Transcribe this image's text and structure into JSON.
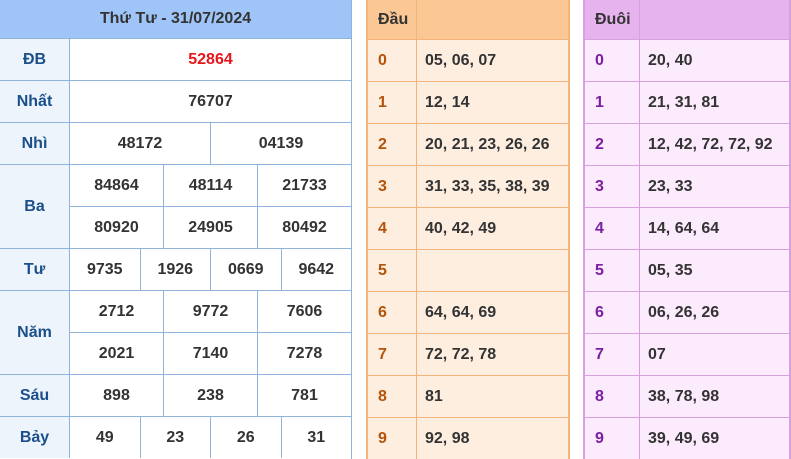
{
  "header": {
    "title": "Thứ Tư - 31/07/2024"
  },
  "prizes": [
    {
      "label": "ĐB",
      "lines": [
        [
          "52864"
        ]
      ],
      "special": true
    },
    {
      "label": "Nhất",
      "lines": [
        [
          "76707"
        ]
      ]
    },
    {
      "label": "Nhì",
      "lines": [
        [
          "48172",
          "04139"
        ]
      ]
    },
    {
      "label": "Ba",
      "lines": [
        [
          "84864",
          "48114",
          "21733"
        ],
        [
          "80920",
          "24905",
          "80492"
        ]
      ]
    },
    {
      "label": "Tư",
      "lines": [
        [
          "9735",
          "1926",
          "0669",
          "9642"
        ]
      ]
    },
    {
      "label": "Năm",
      "lines": [
        [
          "2712",
          "9772",
          "7606"
        ],
        [
          "2021",
          "7140",
          "7278"
        ]
      ]
    },
    {
      "label": "Sáu",
      "lines": [
        [
          "898",
          "238",
          "781"
        ]
      ]
    },
    {
      "label": "Bảy",
      "lines": [
        [
          "49",
          "23",
          "26",
          "31"
        ]
      ]
    }
  ],
  "dau": {
    "header": "Đầu",
    "rows": [
      {
        "key": "0",
        "value": "05, 06, 07"
      },
      {
        "key": "1",
        "value": "12, 14"
      },
      {
        "key": "2",
        "value": "20, 21, 23, 26, 26"
      },
      {
        "key": "3",
        "value": "31, 33, 35, 38, 39"
      },
      {
        "key": "4",
        "value": "40, 42, 49"
      },
      {
        "key": "5",
        "value": ""
      },
      {
        "key": "6",
        "value": "64, 64, 69"
      },
      {
        "key": "7",
        "value": "72, 72, 78"
      },
      {
        "key": "8",
        "value": "81"
      },
      {
        "key": "9",
        "value": "92, 98"
      }
    ]
  },
  "duoi": {
    "header": "Đuôi",
    "rows": [
      {
        "key": "0",
        "value": "20, 40"
      },
      {
        "key": "1",
        "value": "21, 31, 81"
      },
      {
        "key": "2",
        "value": "12, 42, 72, 72, 92"
      },
      {
        "key": "3",
        "value": "23, 33"
      },
      {
        "key": "4",
        "value": "14, 64, 64"
      },
      {
        "key": "5",
        "value": "05, 35"
      },
      {
        "key": "6",
        "value": "06, 26, 26"
      },
      {
        "key": "7",
        "value": "07"
      },
      {
        "key": "8",
        "value": "38, 78, 98"
      },
      {
        "key": "9",
        "value": "39, 49, 69"
      }
    ]
  },
  "colors": {
    "special_number": "#e8161b",
    "results_header_bg": "#9fc5f8",
    "dau_header_bg": "#fbc895",
    "duoi_header_bg": "#e7b3ee"
  }
}
